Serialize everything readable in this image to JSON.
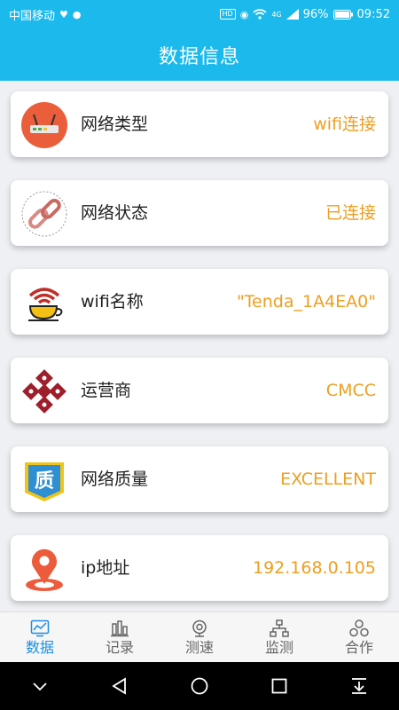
{
  "status_bar": {
    "carrier": "中国移动",
    "battery": "96%",
    "time": "09:52",
    "hd_label": "HD",
    "signal_label": "4G"
  },
  "header": {
    "title": "数据信息"
  },
  "cards": [
    {
      "icon": "router-icon",
      "label": "网络类型",
      "value": "wifi连接"
    },
    {
      "icon": "chain-link-icon",
      "label": "网络状态",
      "value": "已连接"
    },
    {
      "icon": "wifi-cup-icon",
      "label": "wifi名称",
      "value": "\"Tenda_1A4EA0\""
    },
    {
      "icon": "operator-logo-icon",
      "label": "运营商",
      "value": "CMCC"
    },
    {
      "icon": "quality-badge-icon",
      "label": "网络质量",
      "value": "EXCELLENT"
    },
    {
      "icon": "location-pin-icon",
      "label": "ip地址",
      "value": "192.168.0.105"
    }
  ],
  "tabs": [
    {
      "icon": "chart-icon",
      "label": "数据",
      "active": true
    },
    {
      "icon": "record-icon",
      "label": "记录",
      "active": false
    },
    {
      "icon": "speed-test-icon",
      "label": "测速",
      "active": false
    },
    {
      "icon": "network-monitor-icon",
      "label": "监测",
      "active": false
    },
    {
      "icon": "cooperate-icon",
      "label": "合作",
      "active": false
    }
  ],
  "colors": {
    "primary": "#1bb9ec",
    "value_text": "#ee9f21",
    "active_tab": "#1b8fe0"
  }
}
